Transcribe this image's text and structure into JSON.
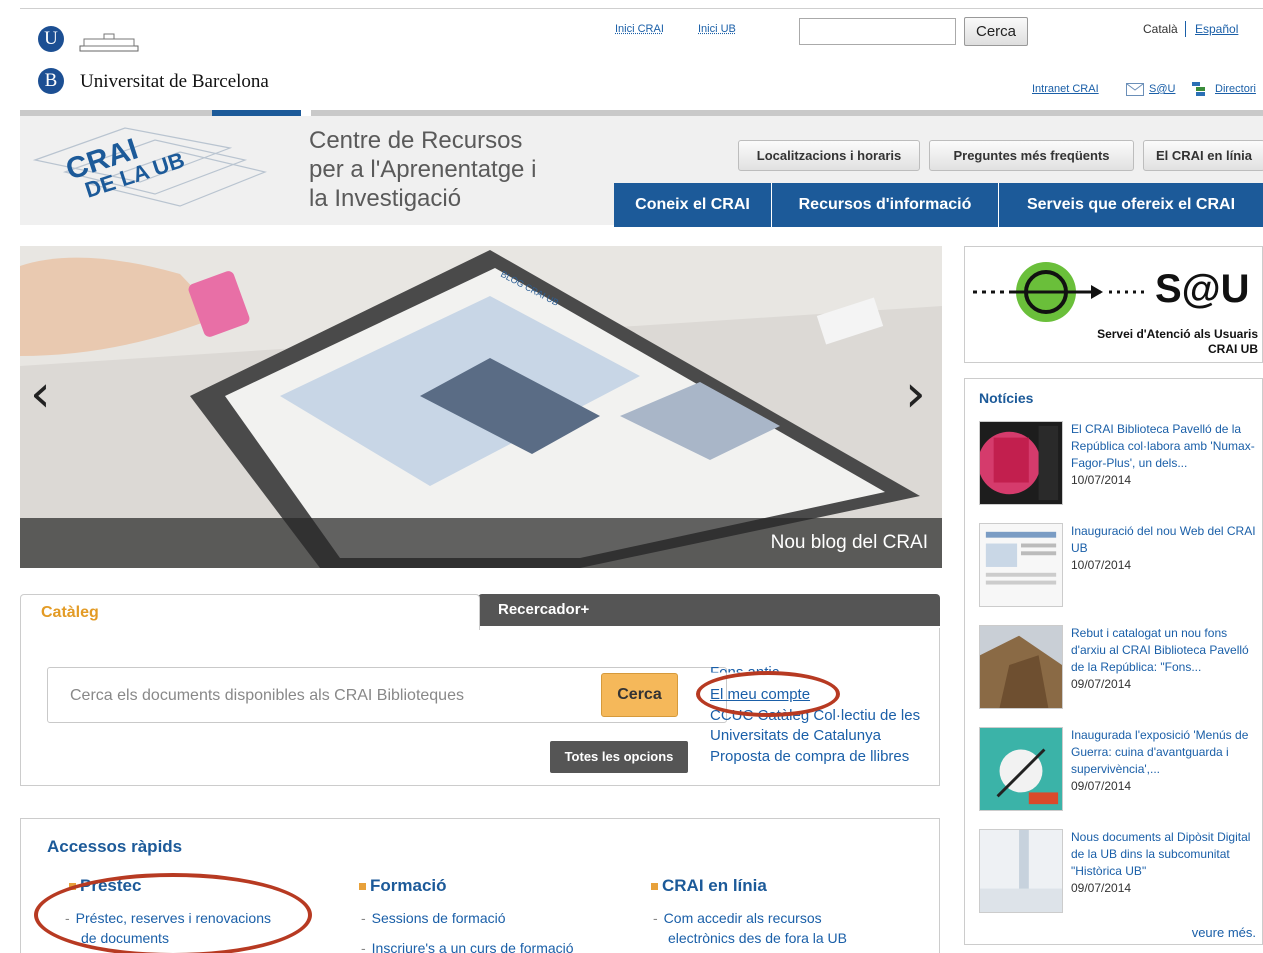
{
  "header": {
    "university_initial_u": "U",
    "university_initial_b": "B",
    "university_name": "Universitat de Barcelona",
    "top_links": [
      "Inici CRAI",
      "Inici UB"
    ],
    "search_button": "Cerca",
    "lang_current": "Català",
    "lang_other": "Español",
    "util_links": [
      "Intranet CRAI",
      "S@U",
      "Directori"
    ]
  },
  "brand": {
    "logo_text_1": "CRAI",
    "logo_text_2": "DE LA UB",
    "title_line1": "Centre de Recursos",
    "title_line2": "per a l'Aprenentatge i",
    "title_line3": "la Investigació"
  },
  "secondary_nav": [
    "Localitzacions i horaris",
    "Preguntes més freqüents",
    "El CRAI en línia"
  ],
  "main_nav": [
    "Coneix el CRAI",
    "Recursos d'informació",
    "Serveis que ofereix el CRAI"
  ],
  "slider": {
    "caption": "Nou blog del CRAI",
    "prev": "‹",
    "next": "›",
    "screen_label": "BLOG CRAI UB"
  },
  "sau": {
    "title": "S@U",
    "subtitle_line1": "Servei d'Atenció als Usuaris",
    "subtitle_line2": "CRAI UB"
  },
  "news": {
    "title": "Notícies",
    "items": [
      {
        "text": "El CRAI Biblioteca Pavelló de la República col·labora amb 'Numax-Fagor-Plus', un dels...",
        "date": "10/07/2014"
      },
      {
        "text": "Inauguració del nou Web del CRAI UB",
        "date": "10/07/2014"
      },
      {
        "text": "Rebut i catalogat un nou fons d'arxiu al CRAI Biblioteca Pavelló de la República: \"Fons...",
        "date": "09/07/2014"
      },
      {
        "text": "Inaugurada l'exposició 'Menús de Guerra: cuina d'avantguarda i supervivència',...",
        "date": "09/07/2014"
      },
      {
        "text": "Nous documents al Dipòsit Digital de la UB dins la subcomunitat \"Històrica UB\"",
        "date": "09/07/2014"
      }
    ],
    "more": "veure més."
  },
  "catalog": {
    "tab_active": "Catàleg",
    "tab_other": "Recercador+",
    "placeholder": "Cerca els documents disponibles als CRAI Biblioteques",
    "search_button": "Cerca",
    "all_options": "Totes les opcions",
    "links": [
      "Fons antic",
      "El meu compte",
      "CCUC Catàleg Col·lectiu de les",
      "Universitats de Catalunya",
      "Proposta de compra de llibres"
    ]
  },
  "quick_access": {
    "title": "Accessos ràpids",
    "columns": [
      {
        "heading": "Préstec",
        "items": [
          "Préstec, reserves i renovacions",
          "de documents"
        ]
      },
      {
        "heading": "Formació",
        "items": [
          "Sessions de formació",
          "Inscriure's a un curs de formació"
        ]
      },
      {
        "heading": "CRAI en línia",
        "items": [
          "Com accedir als recursos",
          "electrònics des de fora la UB"
        ]
      }
    ]
  },
  "colors": {
    "brand_blue": "#1c5a99",
    "accent_orange": "#e39b25",
    "annotation_red": "#b73a22"
  }
}
